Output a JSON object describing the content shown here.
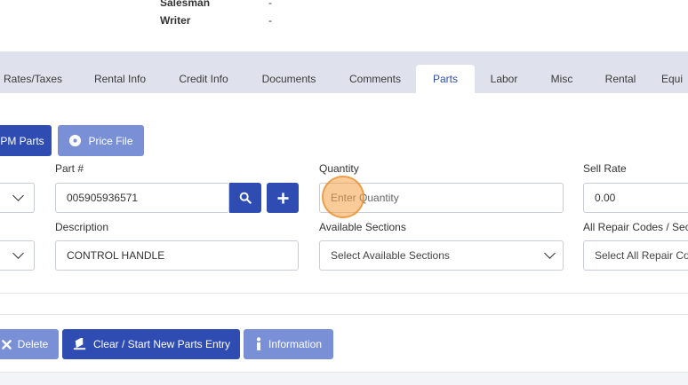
{
  "header_info": {
    "salesman_label": "Salesman",
    "salesman_value": "-",
    "writer_label": "Writer",
    "writer_value": "-"
  },
  "tabs": [
    {
      "label": "Rates/Taxes",
      "active": false
    },
    {
      "label": "Rental Info",
      "active": false
    },
    {
      "label": "Credit Info",
      "active": false
    },
    {
      "label": "Documents",
      "active": false
    },
    {
      "label": "Comments",
      "active": false
    },
    {
      "label": "Parts",
      "active": true
    },
    {
      "label": "Labor",
      "active": false
    },
    {
      "label": "Misc",
      "active": false
    },
    {
      "label": "Rental",
      "active": false
    },
    {
      "label": "Equi",
      "active": false
    }
  ],
  "toolbar": {
    "pm_parts_label": "PM Parts",
    "price_file_label": "Price File"
  },
  "form": {
    "part_label": "Part #",
    "part_value": "005905936571",
    "quantity_label": "Quantity",
    "quantity_placeholder": "Enter Quantity",
    "sell_rate_label": "Sell Rate",
    "sell_rate_value": "0.00",
    "description_label": "Description",
    "description_value": "CONTROL HANDLE",
    "available_sections_label": "Available Sections",
    "available_sections_value": "Select Available Sections",
    "repair_codes_label": "All Repair Codes / Sect",
    "repair_codes_value": "Select All Repair Coc"
  },
  "actions": {
    "delete_label": "Delete",
    "clear_label": "Clear / Start New Parts Entry",
    "information_label": "Information"
  },
  "colors": {
    "primary": "#2f4cb3",
    "primary_light": "#7a90d6",
    "tab_bar": "#dfe1ec",
    "active_tab_text": "#2e4bad"
  }
}
